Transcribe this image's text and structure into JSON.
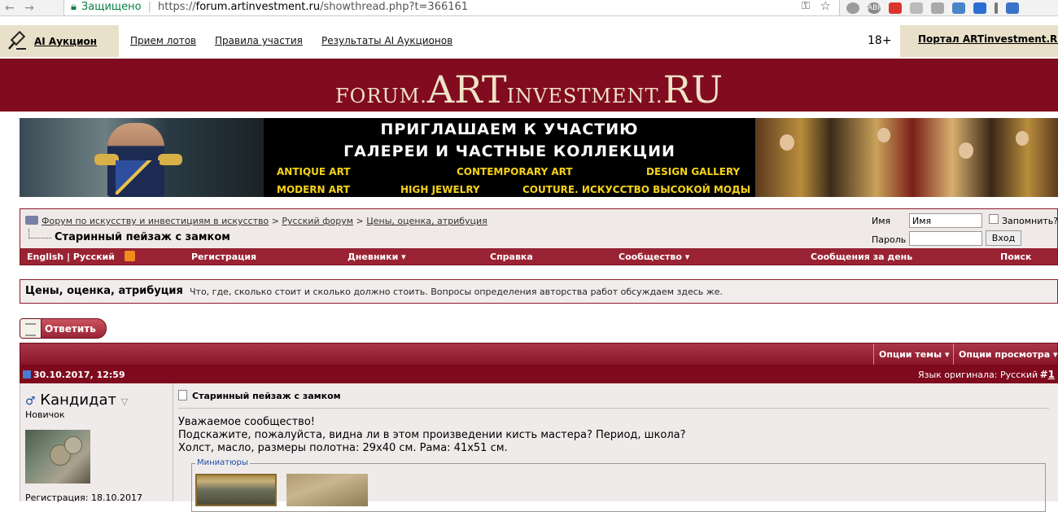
{
  "browser": {
    "back": "←",
    "forward": "→",
    "secure_label": "Защищено",
    "url_prefix": "https://",
    "url_host": "forum.artinvestment.ru",
    "url_path": "/showthread.php?t=366161",
    "extensions": [
      "ABP"
    ]
  },
  "topnav": {
    "auction_label": "AI Аукцион",
    "links": [
      "Прием лотов",
      "Правила участия",
      "Результаты AI Аукционов"
    ],
    "age": "18+",
    "portal": "Портал ARTinvestment.RU"
  },
  "logo": {
    "part1": "FORUM.",
    "part2": "ART",
    "part3": "INVESTMENT.",
    "part4": "RU"
  },
  "banner": {
    "line1": "ПРИГЛАШАЕМ К УЧАСТИЮ",
    "line2": "ГАЛЕРЕИ И ЧАСТНЫЕ КОЛЛЕКЦИИ",
    "tags": [
      "ANTIQUE ART",
      "CONTEMPORARY ART",
      "DESIGN GALLERY",
      "MODERN ART",
      "HIGH JEWELRY",
      "COUTURE. ИСКУССТВО ВЫСОКОЙ МОДЫ"
    ]
  },
  "breadcrumb": {
    "items": [
      "Форум по искусству и инвестициям в искусство",
      "Русский форум",
      "Цены, оценка, атрибуция"
    ],
    "separator": ">",
    "current": "Старинный пейзаж с замком"
  },
  "login": {
    "name_label": "Имя",
    "name_value": "Имя",
    "password_label": "Пароль",
    "remember_label": "Запомнить?",
    "submit_label": "Вход"
  },
  "navbar": {
    "lang": "English | Русский",
    "items": [
      "Регистрация",
      "Дневники",
      "Справка",
      "Сообщество",
      "Сообщения за день",
      "Поиск"
    ]
  },
  "forum": {
    "title": "Цены, оценка, атрибуция",
    "description": "Что, где, сколько стоит и сколько должно стоить. Вопросы определения авторства работ обсуждаем здесь же."
  },
  "reply_label": "Ответить",
  "thread_options": [
    "Опции темы",
    "Опции просмотра"
  ],
  "post": {
    "date": "30.10.2017, 12:59",
    "lang_label": "Язык оригинала: Русский",
    "number_prefix": "#",
    "number": "1",
    "username": "Кандидат",
    "rank": "Новичок",
    "registration": "Регистрация: 18.10.2017",
    "title": "Старинный пейзаж с замком",
    "lines": [
      "Уважаемое сообщество!",
      "Подскажите, пожалуйста, видна ли в этом произведении кисть мастера? Период, школа?",
      "Холст, масло, размеры полотна: 29х40 см. Рама: 41х51 см."
    ],
    "attachments_label": "Миниатюры"
  },
  "colors": {
    "brand": "#810b1f",
    "navbar": "#9a2333",
    "logo_text": "#efe3c8",
    "banner_yellow": "#f5d21a"
  }
}
